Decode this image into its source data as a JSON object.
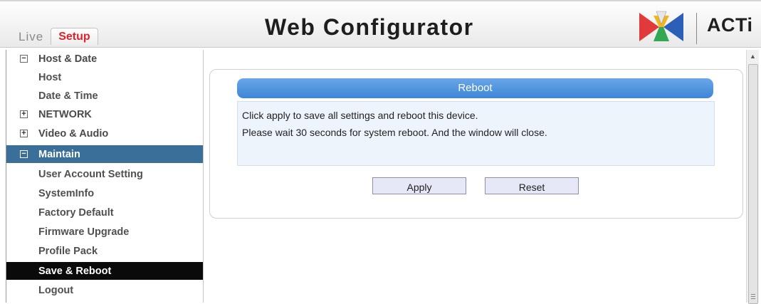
{
  "header": {
    "title": "Web Configurator",
    "tabs": {
      "live": "Live",
      "setup": "Setup"
    },
    "brand": "ACTi"
  },
  "sidebar": {
    "items": [
      {
        "label": "Host & Date",
        "kind": "group",
        "expanded": true
      },
      {
        "label": "Host",
        "kind": "child"
      },
      {
        "label": "Date & Time",
        "kind": "child"
      },
      {
        "label": "NETWORK",
        "kind": "group",
        "expanded": false
      },
      {
        "label": "Video & Audio",
        "kind": "group",
        "expanded": false
      },
      {
        "label": "Maintain",
        "kind": "group",
        "expanded": true,
        "active": true
      },
      {
        "label": "User Account Setting",
        "kind": "child"
      },
      {
        "label": "SystemInfo",
        "kind": "child"
      },
      {
        "label": "Factory Default",
        "kind": "child"
      },
      {
        "label": "Firmware Upgrade",
        "kind": "child"
      },
      {
        "label": "Profile Pack",
        "kind": "child"
      },
      {
        "label": "Save & Reboot",
        "kind": "child",
        "selected": true
      },
      {
        "label": "Logout",
        "kind": "child"
      }
    ],
    "icons": {
      "collapse": "minus-box-icon",
      "expand": "plus-box-icon"
    }
  },
  "panel": {
    "title": "Reboot",
    "message_line1": "Click apply to save all settings and reboot this device.",
    "message_line2": "Please wait 30 seconds for system reboot. And the window will close.",
    "apply_label": "Apply",
    "reset_label": "Reset"
  },
  "colors": {
    "accent_blue": "#3d86d6",
    "active_item": "#3a6f9a",
    "selected_item": "#0a0a0a",
    "setup_tab": "#e0202a"
  }
}
